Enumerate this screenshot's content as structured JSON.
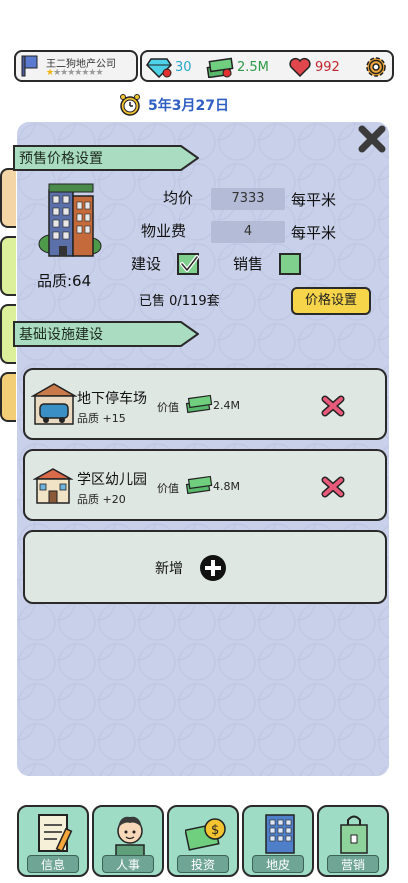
{
  "company": {
    "name": "王二狗地产公司",
    "stars_on": 1,
    "stars_total": 8
  },
  "resources": {
    "gems": "30",
    "cash": "2.5M",
    "hearts": "992"
  },
  "date": "5年3月27日",
  "presale": {
    "section_title": "预售价格设置",
    "quality_label": "品质:64",
    "avg_price_label": "均价",
    "avg_price_value": "7333",
    "avg_price_unit": "每平米",
    "fee_label": "物业费",
    "fee_value": "4",
    "fee_unit": "每平米",
    "build_label": "建设",
    "build_checked": true,
    "sale_label": "销售",
    "sale_checked": false,
    "sold_text": "已售 0/119套",
    "price_button": "价格设置"
  },
  "infrastructure": {
    "section_title": "基础设施建设",
    "items": [
      {
        "name": "地下停车场",
        "quality": "品质 +15",
        "value_label": "价值",
        "value": "2.4M",
        "icon": "parking-garage-icon"
      },
      {
        "name": "学区幼儿园",
        "quality": "品质 +20",
        "value_label": "价值",
        "value": "4.8M",
        "icon": "kindergarten-icon"
      }
    ],
    "add_label": "新增"
  },
  "nav": [
    {
      "label": "信息",
      "icon": "notepad-icon"
    },
    {
      "label": "人事",
      "icon": "person-icon"
    },
    {
      "label": "投资",
      "icon": "money-icon"
    },
    {
      "label": "地皮",
      "icon": "building-icon"
    },
    {
      "label": "营销",
      "icon": "shopping-bag-icon"
    }
  ],
  "colors": {
    "accent_blue": "#2f5fc4",
    "panel": "#c9d0e9",
    "nav": "#9fdcc6",
    "price_button": "#f6d54a",
    "checkbox": "#7fcf8d"
  }
}
